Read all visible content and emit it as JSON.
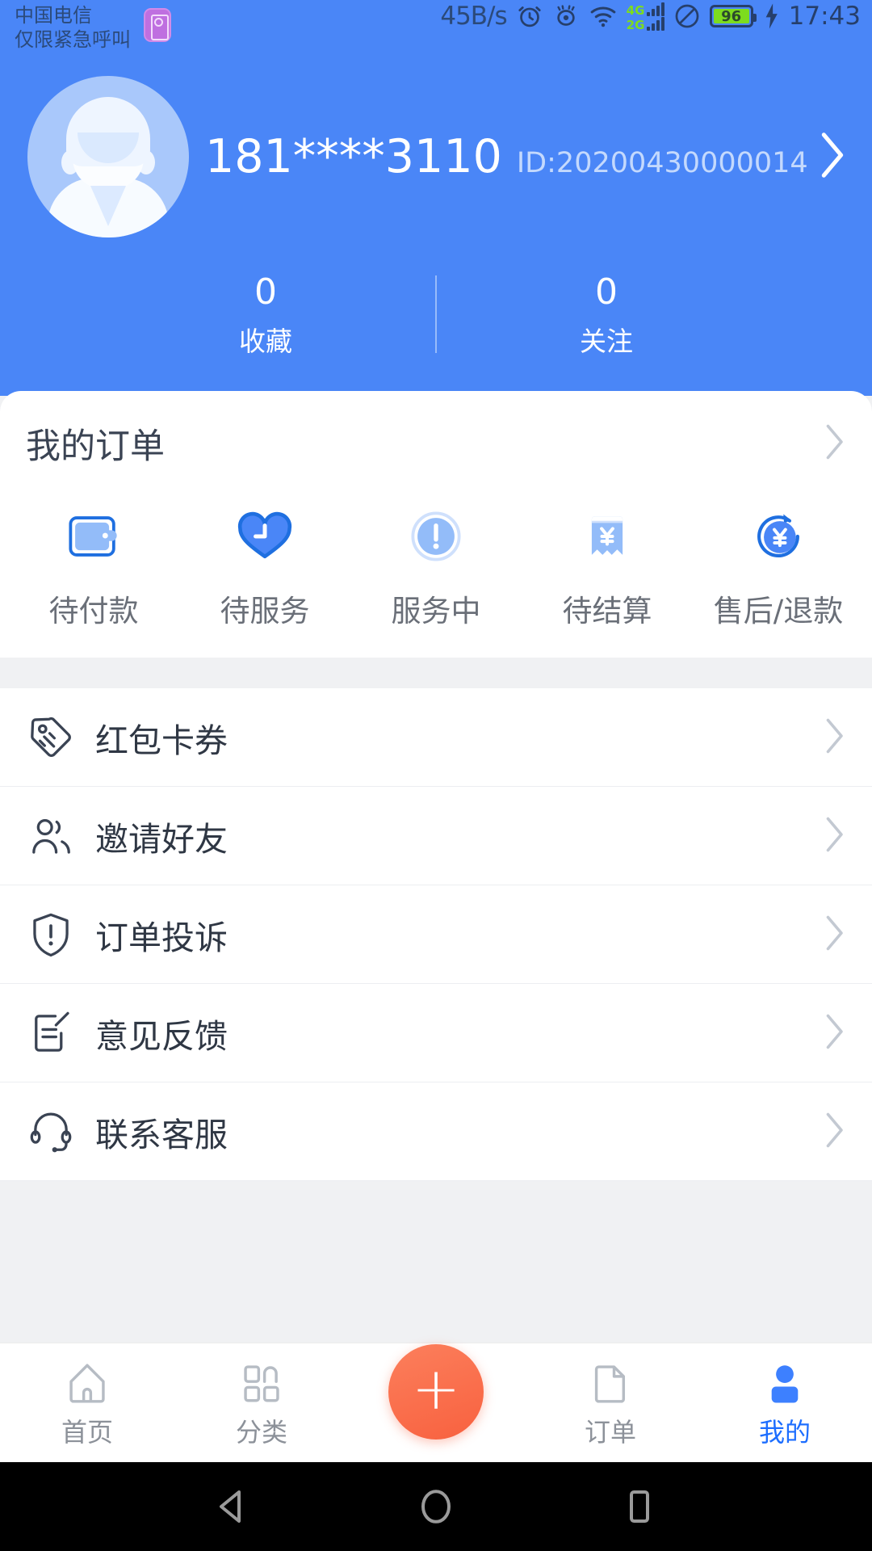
{
  "statusbar": {
    "carrier_line1": "中国电信",
    "carrier_line2": "仅限紧急呼叫",
    "sim_icon": "sim-card-icon",
    "net_speed": "45B/s",
    "alarm_icon": "alarm-clock-icon",
    "eye_icon": "eye-care-icon",
    "wifi_icon": "wifi-icon",
    "signal_4g_label": "4G",
    "signal_2g_label": "2G",
    "dnd_icon": "do-not-disturb-icon",
    "battery_percent": "96",
    "charging_icon": "lightning-bolt-icon",
    "clock": "17:43"
  },
  "header": {
    "avatar": "default-user-avatar",
    "phone": "181****3110",
    "user_id": "ID:20200430000014",
    "chevron": "chevron-right-icon",
    "stats": [
      {
        "count": "0",
        "label": "收藏"
      },
      {
        "count": "0",
        "label": "关注"
      }
    ]
  },
  "orders": {
    "title": "我的订单",
    "chevron": "chevron-right-icon",
    "statuses": [
      {
        "label": "待付款",
        "icon": "wallet-icon"
      },
      {
        "label": "待服务",
        "icon": "heart-clock-icon"
      },
      {
        "label": "服务中",
        "icon": "exclamation-circle-icon"
      },
      {
        "label": "待结算",
        "icon": "receipt-yuan-icon"
      },
      {
        "label": "售后/退款",
        "icon": "refund-yuan-icon"
      }
    ]
  },
  "menu": {
    "items": [
      {
        "label": "红包卡券",
        "icon": "coupon-tag-icon"
      },
      {
        "label": "邀请好友",
        "icon": "invite-friends-icon"
      },
      {
        "label": "订单投诉",
        "icon": "shield-complaint-icon"
      },
      {
        "label": "意见反馈",
        "icon": "feedback-edit-icon"
      },
      {
        "label": "联系客服",
        "icon": "headset-support-icon"
      }
    ],
    "chevron": "chevron-right-icon"
  },
  "tabbar": {
    "tabs": [
      {
        "label": "首页",
        "icon": "home-icon",
        "active": false
      },
      {
        "label": "分类",
        "icon": "category-icon",
        "active": false
      },
      {
        "label": "订单",
        "icon": "document-icon",
        "active": false
      },
      {
        "label": "我的",
        "icon": "profile-icon",
        "active": true
      }
    ],
    "fab": {
      "label": "+",
      "icon": "plus-icon"
    }
  },
  "sysnav": {
    "back": "back-triangle-icon",
    "home": "home-circle-icon",
    "recents": "recents-square-icon"
  },
  "colors": {
    "brand_blue": "#4a86f7",
    "active_blue": "#1d6eff",
    "fab_orange": "#f8613f",
    "divider_gray": "#f0f1f3"
  }
}
